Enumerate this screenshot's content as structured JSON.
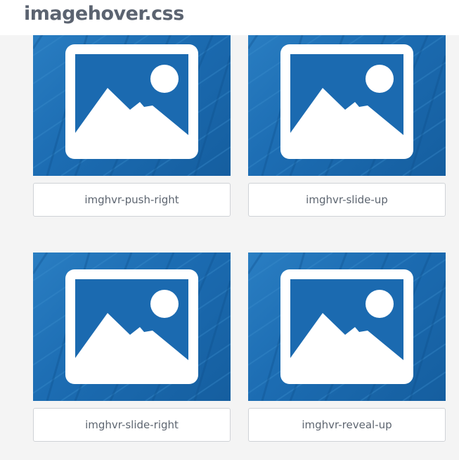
{
  "header": {
    "logo": "imagehover.css"
  },
  "cards": [
    {
      "label": "imghvr-push-right",
      "image_icon": "image-placeholder-icon"
    },
    {
      "label": "imghvr-slide-up",
      "image_icon": "image-placeholder-icon"
    },
    {
      "label": "imghvr-slide-right",
      "image_icon": "image-placeholder-icon"
    },
    {
      "label": "imghvr-reveal-up",
      "image_icon": "image-placeholder-icon"
    }
  ],
  "colors": {
    "thumbnail_blue": "#1c6cb2",
    "page_background": "#f4f4f4",
    "logo_text": "#5b6370",
    "label_text": "#5d6570"
  }
}
